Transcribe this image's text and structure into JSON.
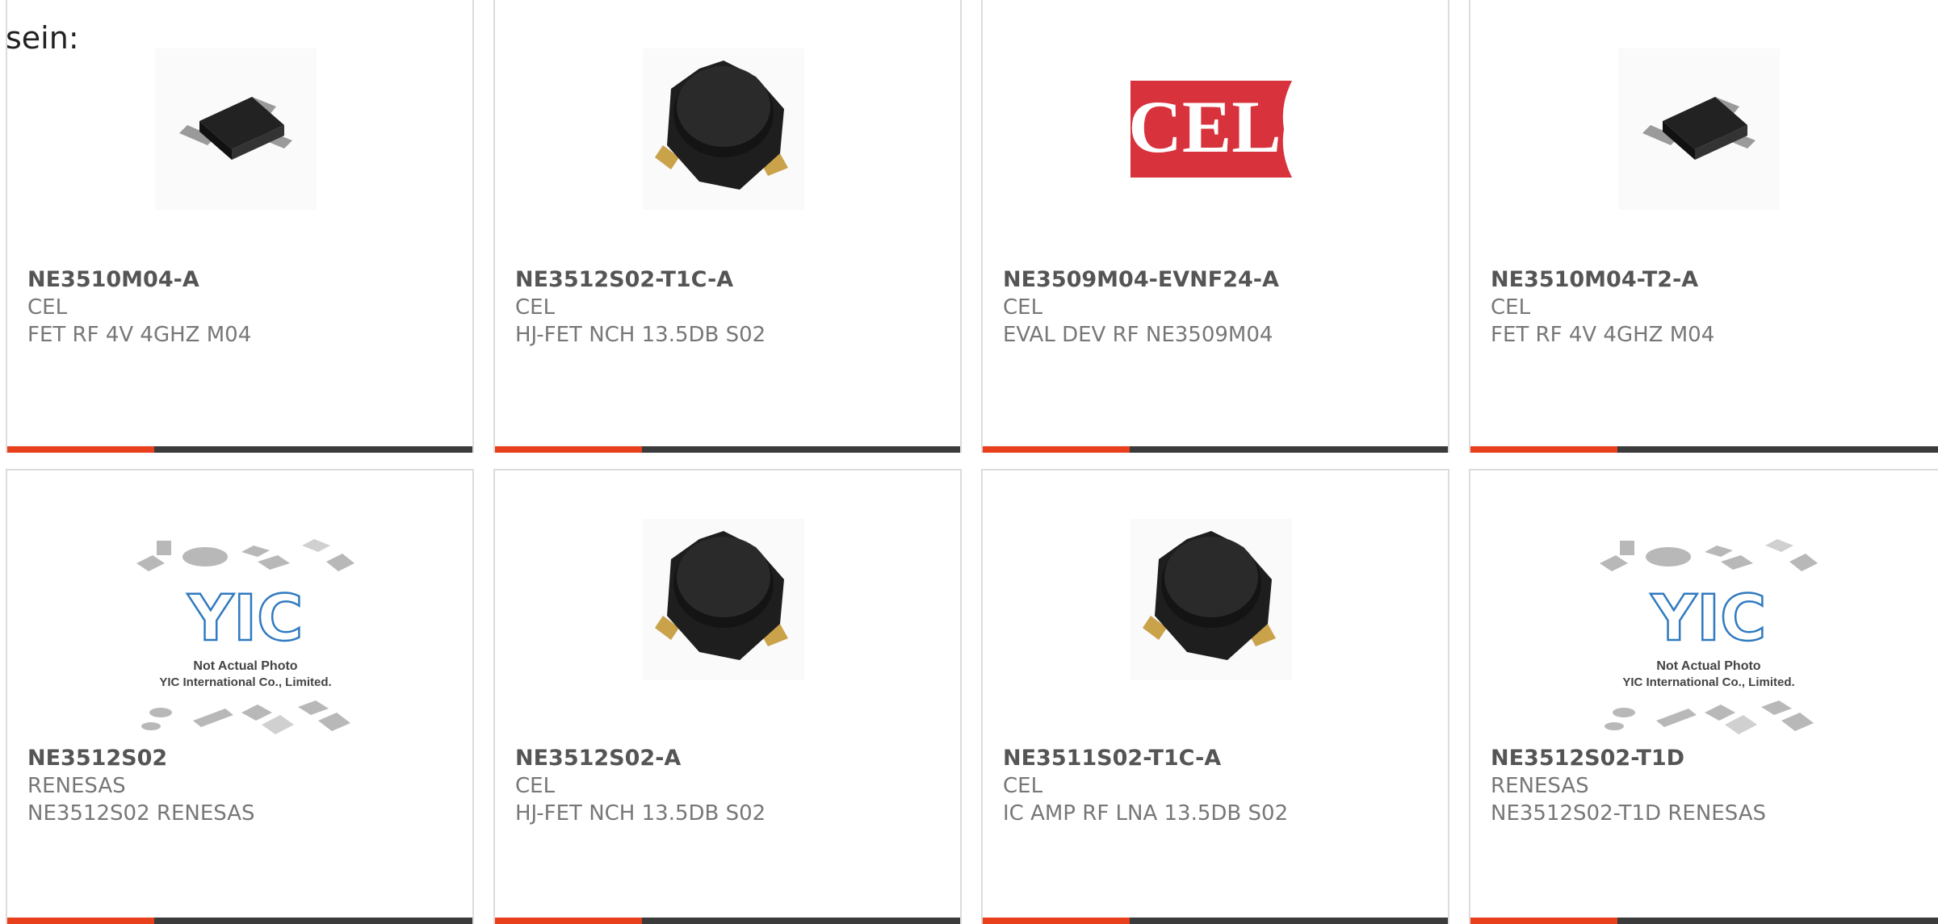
{
  "intro_text": "sein:",
  "colors": {
    "accent": "#e8401c",
    "bar": "#3b3b3b",
    "cel_red": "#d8323c"
  },
  "placeholder_text": {
    "line1": "Not Actual Photo",
    "line2": "YIC International Co., Limited.",
    "logo": "YIC"
  },
  "cel_logo_text": "CEL",
  "products": [
    {
      "part_number": "NE3510M04-A",
      "manufacturer": "CEL",
      "description": "FET RF 4V 4GHZ M04",
      "image": "sot-package-icon"
    },
    {
      "part_number": "NE3512S02-T1C-A",
      "manufacturer": "CEL",
      "description": "HJ-FET NCH 13.5DB S02",
      "image": "s02-package-icon"
    },
    {
      "part_number": "NE3509M04-EVNF24-A",
      "manufacturer": "CEL",
      "description": "EVAL DEV RF NE3509M04",
      "image": "cel-logo"
    },
    {
      "part_number": "NE3510M04-T2-A",
      "manufacturer": "CEL",
      "description": "FET RF 4V 4GHZ M04",
      "image": "sot-package-icon"
    },
    {
      "part_number": "NE3512S02",
      "manufacturer": "RENESAS",
      "description": "NE3512S02 RENESAS",
      "image": "not-actual-photo-placeholder"
    },
    {
      "part_number": "NE3512S02-A",
      "manufacturer": "CEL",
      "description": "HJ-FET NCH 13.5DB S02",
      "image": "s02-package-icon"
    },
    {
      "part_number": "NE3511S02-T1C-A",
      "manufacturer": "CEL",
      "description": "IC AMP RF LNA 13.5DB S02",
      "image": "s02-package-icon"
    },
    {
      "part_number": "NE3512S02-T1D",
      "manufacturer": "RENESAS",
      "description": "NE3512S02-T1D RENESAS",
      "image": "not-actual-photo-placeholder"
    }
  ]
}
